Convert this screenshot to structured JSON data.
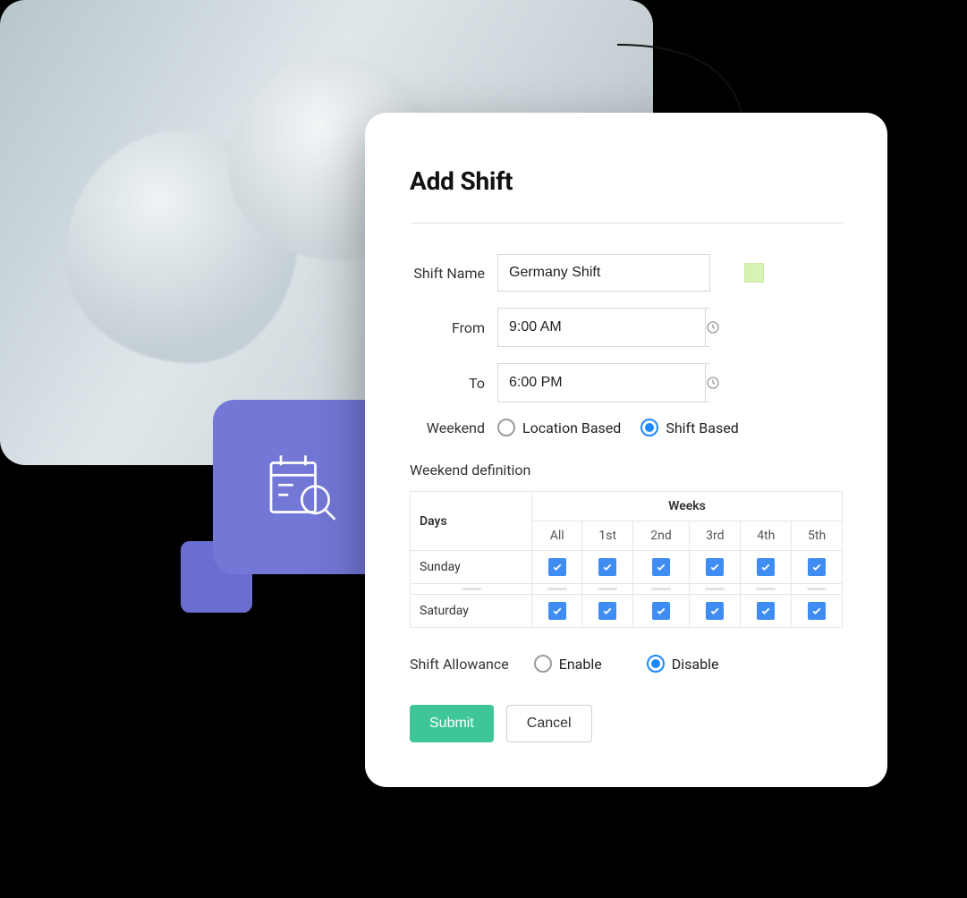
{
  "title": "Add Shift",
  "labels": {
    "shift_name": "Shift Name",
    "from": "From",
    "to": "To",
    "weekend": "Weekend",
    "weekend_definition": "Weekend definition",
    "shift_allowance": "Shift Allowance",
    "days": "Days",
    "weeks": "Weeks"
  },
  "fields": {
    "shift_name": "Germany Shift",
    "from": "9:00 AM",
    "to": "6:00 PM"
  },
  "weekend_options": {
    "location": "Location Based",
    "shift": "Shift Based",
    "selected": "shift"
  },
  "week_columns": [
    "All",
    "1st",
    "2nd",
    "3rd",
    "4th",
    "5th"
  ],
  "weekend_rows": [
    {
      "day": "Sunday",
      "checks": [
        true,
        true,
        true,
        true,
        true,
        true
      ]
    },
    {
      "day": "Saturday",
      "checks": [
        true,
        true,
        true,
        true,
        true,
        true
      ]
    }
  ],
  "allowance": {
    "enable": "Enable",
    "disable": "Disable",
    "selected": "disable"
  },
  "buttons": {
    "submit": "Submit",
    "cancel": "Cancel"
  },
  "colors": {
    "accent": "#1e88ff",
    "primary_button": "#3ec59a",
    "check": "#3f8cf3",
    "swatch": "#d7f3b2",
    "tile": "#7377d6"
  }
}
